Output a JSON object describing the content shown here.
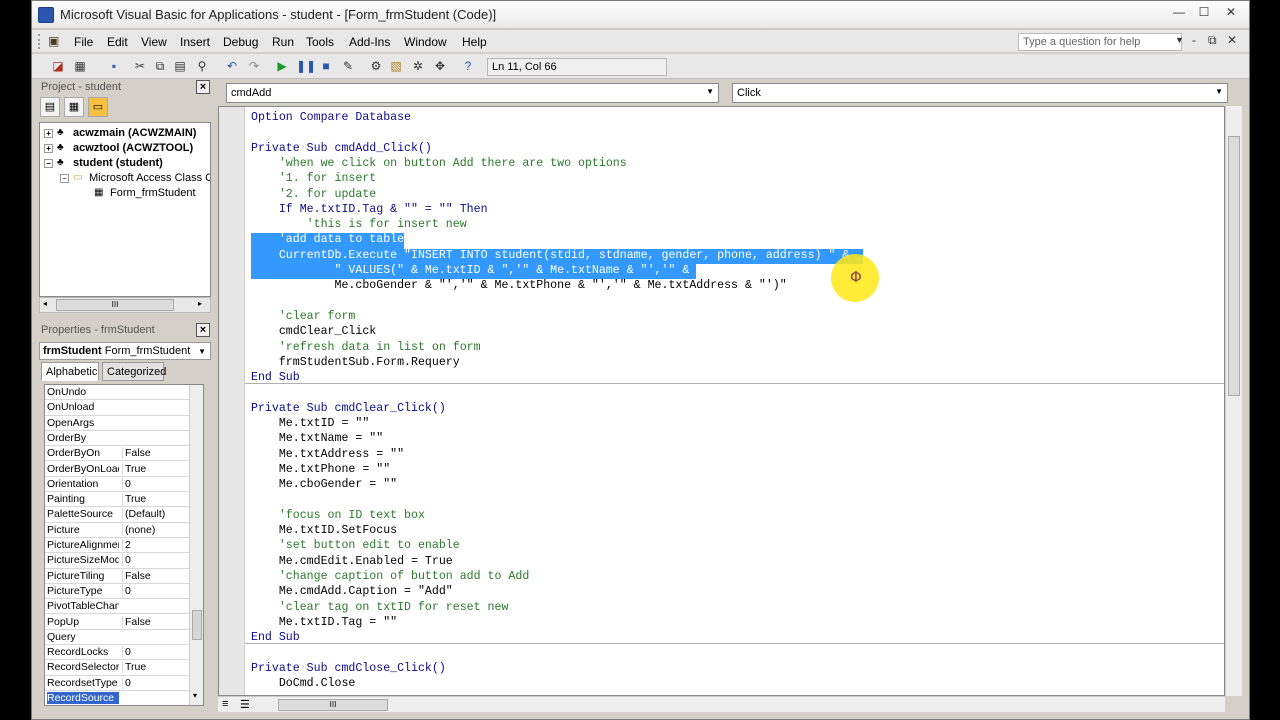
{
  "window": {
    "title": "Microsoft Visual Basic for Applications - student - [Form_frmStudent (Code)]",
    "controls": {
      "min": "—",
      "max": "☐",
      "close": "✕"
    }
  },
  "menu": {
    "items": [
      "File",
      "Edit",
      "View",
      "Insert",
      "Debug",
      "Run",
      "Tools",
      "Add-Ins",
      "Window",
      "Help"
    ],
    "ask_placeholder": "Type a question for help",
    "mdi": {
      "min": "‑",
      "restore": "⧉",
      "close": "✕"
    }
  },
  "toolbar": {
    "status": "Ln 11, Col 66"
  },
  "project": {
    "title": "Project - student",
    "close": "×",
    "tree": [
      {
        "label": "acwzmain (ACWZMAIN)",
        "bold": true
      },
      {
        "label": "acwztool (ACWZTOOL)",
        "bold": true
      },
      {
        "label": "student (student)",
        "bold": true
      },
      {
        "label": "Microsoft Access Class C",
        "bold": false
      },
      {
        "label": "Form_frmStudent",
        "bold": false
      }
    ],
    "hscroll_mark": "III"
  },
  "properties": {
    "title": "Properties - frmStudent",
    "close": "×",
    "object_name": "frmStudent",
    "object_type": "Form_frmStudent",
    "tabs": [
      "Alphabetic",
      "Categorized"
    ],
    "rows": [
      {
        "name": "OnUndo",
        "value": ""
      },
      {
        "name": "OnUnload",
        "value": ""
      },
      {
        "name": "OpenArgs",
        "value": ""
      },
      {
        "name": "OrderBy",
        "value": ""
      },
      {
        "name": "OrderByOn",
        "value": "False"
      },
      {
        "name": "OrderByOnLoad",
        "value": "True"
      },
      {
        "name": "Orientation",
        "value": "0"
      },
      {
        "name": "Painting",
        "value": "True"
      },
      {
        "name": "PaletteSource",
        "value": "(Default)"
      },
      {
        "name": "Picture",
        "value": "(none)"
      },
      {
        "name": "PictureAlignment",
        "value": "2"
      },
      {
        "name": "PictureSizeMode",
        "value": "0"
      },
      {
        "name": "PictureTiling",
        "value": "False"
      },
      {
        "name": "PictureType",
        "value": "0"
      },
      {
        "name": "PivotTableChange",
        "value": ""
      },
      {
        "name": "PopUp",
        "value": "False"
      },
      {
        "name": "Query",
        "value": ""
      },
      {
        "name": "RecordLocks",
        "value": "0"
      },
      {
        "name": "RecordSelectors",
        "value": "True"
      },
      {
        "name": "RecordsetType",
        "value": "0"
      },
      {
        "name": "RecordSource",
        "value": ""
      }
    ]
  },
  "code": {
    "object_combo": "cmdAdd",
    "proc_combo": "Click",
    "lines": [
      {
        "t": "Option Compare Database",
        "c": "kw"
      },
      {
        "t": "",
        "c": ""
      },
      {
        "t": "Private Sub cmdAdd_Click()",
        "c": "kw"
      },
      {
        "t": "    'when we click on button Add there are two options",
        "c": "cm"
      },
      {
        "t": "    '1. for insert",
        "c": "cm"
      },
      {
        "t": "    '2. for update",
        "c": "cm"
      },
      {
        "t": "    If Me.txtID.Tag & \"\" = \"\" Then",
        "c": "kw"
      },
      {
        "t": "        'this is for insert new",
        "c": "cm"
      },
      {
        "t": "    'add data to table",
        "c": "sel"
      },
      {
        "t": "    CurrentDb.Execute \"INSERT INTO student(stdid, stdname, gender, phone, address) \" & _",
        "c": "sel"
      },
      {
        "t": "            \" VALUES(\" & Me.txtID & \",'\" & Me.txtName & \"','\" & ",
        "c": "sel"
      },
      {
        "t": "            Me.cboGender & \"','\" & Me.txtPhone & \"','\" & Me.txtAddress & \"')\"",
        "c": ""
      },
      {
        "t": "",
        "c": ""
      },
      {
        "t": "    'clear form",
        "c": "cm"
      },
      {
        "t": "    cmdClear_Click",
        "c": ""
      },
      {
        "t": "    'refresh data in list on form",
        "c": "cm"
      },
      {
        "t": "    frmStudentSub.Form.Requery",
        "c": ""
      },
      {
        "t": "End Sub",
        "c": "kw"
      },
      {
        "t": "",
        "c": ""
      },
      {
        "t": "Private Sub cmdClear_Click()",
        "c": "kw"
      },
      {
        "t": "    Me.txtID = \"\"",
        "c": ""
      },
      {
        "t": "    Me.txtName = \"\"",
        "c": ""
      },
      {
        "t": "    Me.txtAddress = \"\"",
        "c": ""
      },
      {
        "t": "    Me.txtPhone = \"\"",
        "c": ""
      },
      {
        "t": "    Me.cboGender = \"\"",
        "c": ""
      },
      {
        "t": "",
        "c": ""
      },
      {
        "t": "    'focus on ID text box",
        "c": "cm"
      },
      {
        "t": "    Me.txtID.SetFocus",
        "c": ""
      },
      {
        "t": "    'set button edit to enable",
        "c": "cm"
      },
      {
        "t": "    Me.cmdEdit.Enabled = True",
        "c": ""
      },
      {
        "t": "    'change caption of button add to Add",
        "c": "cm"
      },
      {
        "t": "    Me.cmdAdd.Caption = \"Add\"",
        "c": ""
      },
      {
        "t": "    'clear tag on txtID for reset new",
        "c": "cm"
      },
      {
        "t": "    Me.txtID.Tag = \"\"",
        "c": ""
      },
      {
        "t": "End Sub",
        "c": "kw"
      },
      {
        "t": "",
        "c": ""
      },
      {
        "t": "Private Sub cmdClose_Click()",
        "c": "kw"
      },
      {
        "t": "    DoCmd.Close",
        "c": ""
      }
    ],
    "hscroll_mark": "III"
  }
}
